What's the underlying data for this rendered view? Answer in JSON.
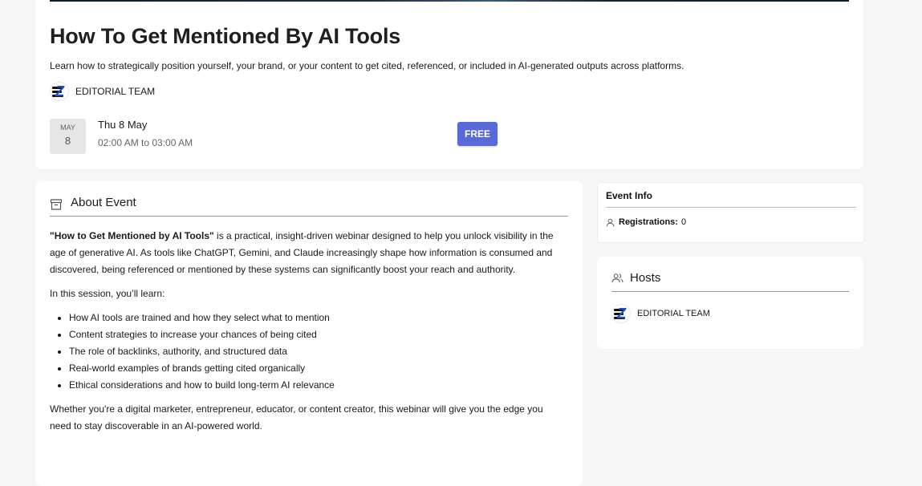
{
  "event": {
    "title": "How To Get Mentioned By AI Tools",
    "subtitle": "Learn how to strategically position yourself, your brand, or your content to get cited, referenced, or included in AI-generated outputs across platforms.",
    "organizer": "EDITORIAL TEAM",
    "date_badge": {
      "month": "MAY",
      "day": "8"
    },
    "date_line": "Thu 8 May",
    "time_line": "02:00 AM to 03:00 AM",
    "price_label": "FREE"
  },
  "about": {
    "heading": "About Event",
    "intro_bold": "\"How to Get Mentioned by AI Tools\"",
    "intro_rest": " is a practical, insight-driven webinar designed to help you unlock visibility in the age of generative AI. As tools like ChatGPT, Gemini, and Claude increasingly shape how information is consumed and discovered, being referenced or mentioned by these systems can significantly boost your reach and authority.",
    "learn_lead": "In this session, you’ll learn:",
    "points": [
      "How AI tools are trained and how they select what to mention",
      "Content strategies to increase your chances of being cited",
      "The role of backlinks, authority, and structured data",
      "Real-world examples of brands getting cited organically",
      "Ethical considerations and how to build long-term AI relevance"
    ],
    "closing": "Whether you're a digital marketer, entrepreneur, educator, or content creator, this webinar will give you the edge you need to stay discoverable in an AI-powered world."
  },
  "event_info": {
    "heading": "Event Info",
    "registrations_label": "Registrations:",
    "registrations_value": "0"
  },
  "hosts": {
    "heading": "Hosts",
    "items": [
      "EDITORIAL TEAM"
    ]
  },
  "colors": {
    "accent": "#5a69d8",
    "logo_blue": "#1e4fc4"
  }
}
